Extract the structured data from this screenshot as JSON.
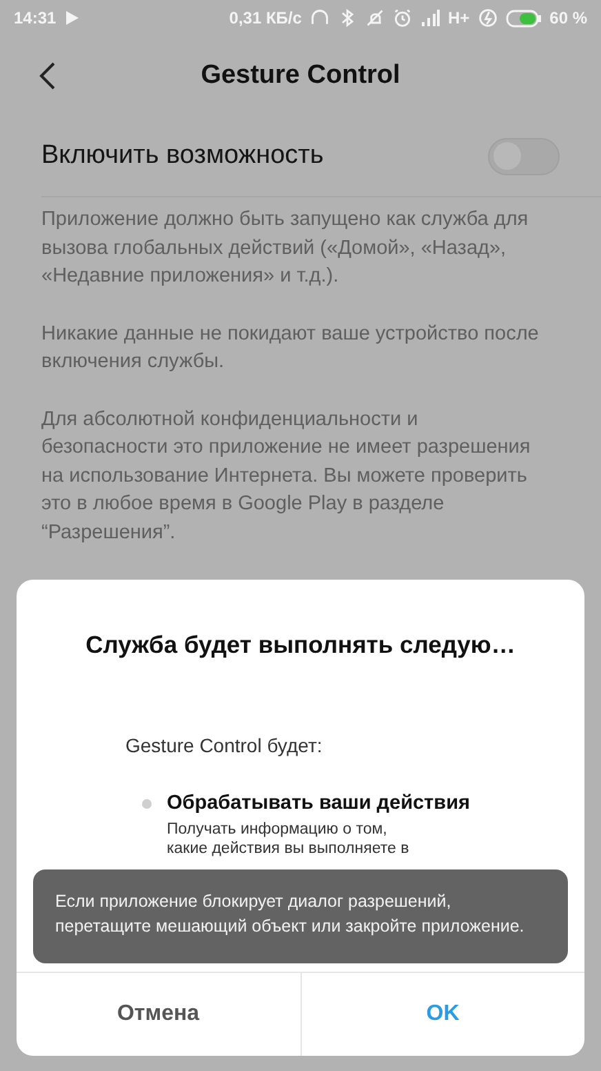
{
  "status_bar": {
    "time": "14:31",
    "speed": "0,31 КБ/с",
    "network": "H+",
    "battery": "60 %"
  },
  "header": {
    "title": "Gesture Control"
  },
  "setting": {
    "label": "Включить возможность",
    "on": false
  },
  "paragraphs": [
    "Приложение должно быть запущено как служба для вызова глобальных действий («Домой», «Назад», «Недавние приложения» и т.д.).",
    "Никакие данные не покидают ваше устройство после включения службы.",
    "Для абсолютной конфиденциальности и безопасности это приложение не имеет разрешения на использование Интернета. Вы можете проверить это в любое время в Google Play в разделе “Разрешения”."
  ],
  "dialog": {
    "title": "Служба будет выполнять следую…",
    "intro": "Gesture Control будет:",
    "items": [
      {
        "title": "Обрабатывать ваши действия",
        "description": "Получать информацию о том,\nкакие действия вы выполняете в"
      }
    ],
    "toast": "Если приложение блокирует диалог разрешений, перетащите мешающий объект или закройте приложение.",
    "buttons": [
      {
        "label": "Отмена",
        "kind": "cancel"
      },
      {
        "label": "OK",
        "kind": "confirm"
      }
    ]
  }
}
